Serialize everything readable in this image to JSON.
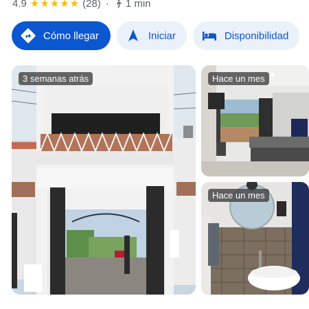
{
  "rating": {
    "value": "4.9",
    "stars": [
      "★",
      "★",
      "★",
      "★",
      "★"
    ],
    "count": "(28)",
    "separator": "·",
    "walk_time": "1 min"
  },
  "actions": {
    "directions_label": "Cómo llegar",
    "start_label": "Iniciar",
    "availability_label": "Disponibilidad"
  },
  "photos": [
    {
      "label": "3 semanas atrás"
    },
    {
      "label": "Hace un mes"
    },
    {
      "label": "Hace un mes"
    }
  ],
  "colors": {
    "primary_blue": "#0b57d0",
    "chip_background": "#eaf1fb",
    "star_yellow": "#fbbc04"
  }
}
